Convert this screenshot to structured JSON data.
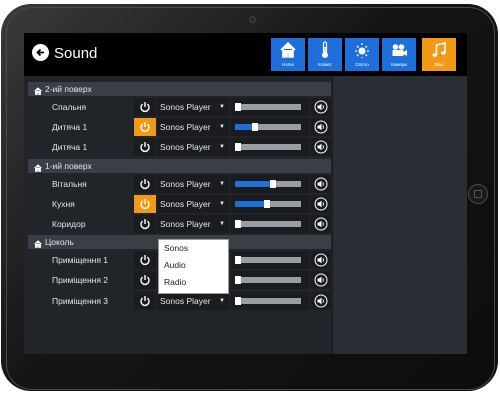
{
  "header": {
    "title": "Sound"
  },
  "nav": [
    {
      "label": "Home",
      "icon": "home-icon",
      "active": false
    },
    {
      "label": "Клімат",
      "icon": "thermometer-icon",
      "active": false
    },
    {
      "label": "Світло",
      "icon": "sun-icon",
      "active": false
    },
    {
      "label": "Камери",
      "icon": "camera-icon",
      "active": false
    },
    {
      "label": "Звук",
      "icon": "music-icon",
      "active": true
    }
  ],
  "sections": [
    {
      "title": "2-ий поверх",
      "rooms": [
        {
          "name": "Спальня",
          "power_on": false,
          "player": "Sonos Player",
          "volume": 0.0
        },
        {
          "name": "Дитяча 1",
          "power_on": true,
          "player": "Sonos Player",
          "volume": 0.3
        },
        {
          "name": "Дитяча 1",
          "power_on": false,
          "player": "Sonos Player",
          "volume": 0.0
        }
      ]
    },
    {
      "title": "1-ий поверх",
      "rooms": [
        {
          "name": "Вітальня",
          "power_on": false,
          "player": "Sonos Player",
          "volume": 0.58
        },
        {
          "name": "Кухня",
          "power_on": true,
          "player": "Sonos Player",
          "volume": 0.48
        },
        {
          "name": "Коридор",
          "power_on": false,
          "player": "Sonos Player",
          "volume": 0.0
        }
      ]
    },
    {
      "title": "Цоколь",
      "rooms": [
        {
          "name": "Приміщення 1",
          "power_on": false,
          "player": "Sonos Player",
          "volume": 0.0
        },
        {
          "name": "Приміщення 2",
          "power_on": false,
          "player": "Sonos Player",
          "volume": 0.0
        },
        {
          "name": "Приміщення 3",
          "power_on": false,
          "player": "Sonos Player",
          "volume": 0.0
        }
      ]
    }
  ],
  "dropdown": {
    "options": [
      "Sonos",
      "Audio",
      "Radio"
    ]
  },
  "colors": {
    "accent": "#f29a16",
    "primary": "#1e6fd9",
    "background": "#212429"
  }
}
